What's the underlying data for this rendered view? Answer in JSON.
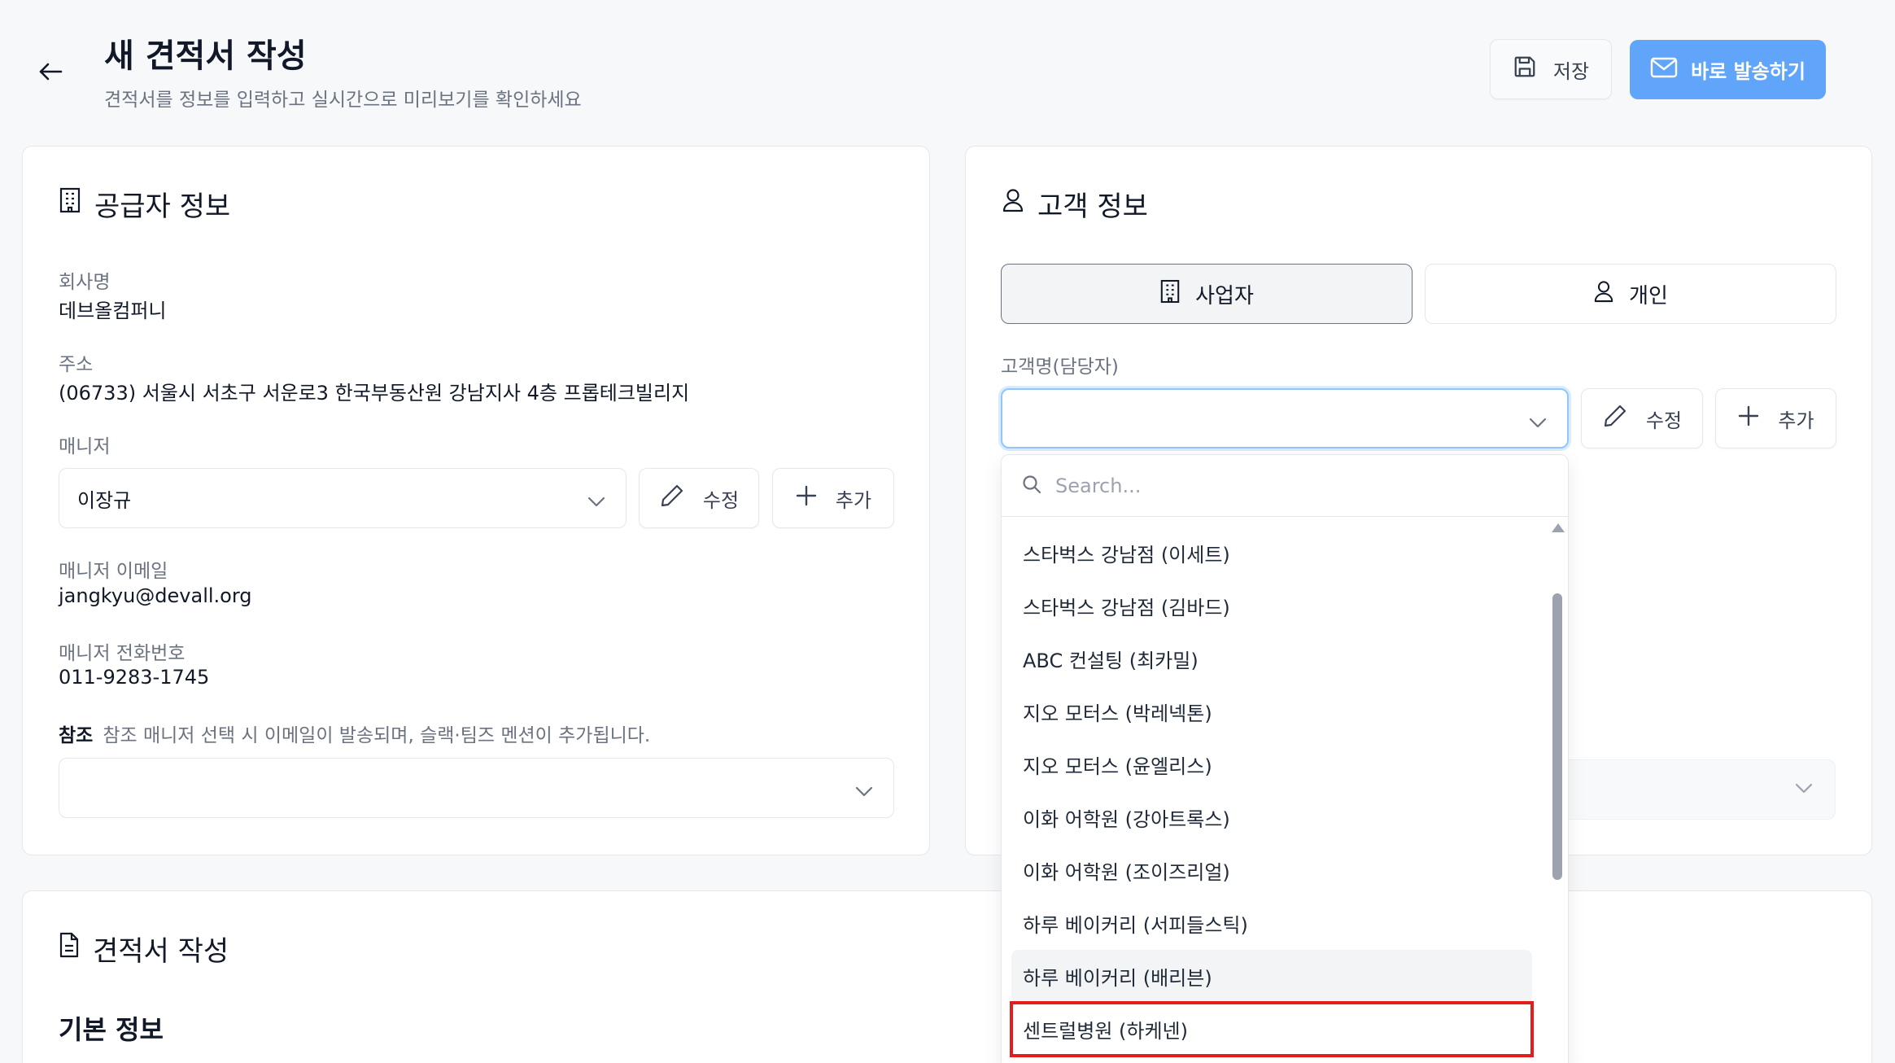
{
  "header": {
    "title": "새 견적서 작성",
    "subtitle": "견적서를 정보를 입력하고 실시간으로 미리보기를 확인하세요",
    "save_label": "저장",
    "send_label": "바로 발송하기"
  },
  "supplier": {
    "title": "공급자 정보",
    "company_label": "회사명",
    "company_value": "데브올컴퍼니",
    "address_label": "주소",
    "address_value": "(06733) 서울시 서초구 서운로3 한국부동산원 강남지사 4층 프롭테크빌리지",
    "manager_label": "매니저",
    "manager_value": "이장규",
    "edit_label": "수정",
    "add_label": "추가",
    "email_label": "매니저 이메일",
    "email_value": "jangkyu@devall.org",
    "phone_label": "매니저 전화번호",
    "phone_value": "011-9283-1745",
    "ref_label": "참조",
    "ref_help": "참조 매니저 선택 시 이메일이 발송되며, 슬랙·팀즈 멘션이 추가됩니다.",
    "ref_value": ""
  },
  "customer": {
    "title": "고객 정보",
    "tab_business": "사업자",
    "tab_individual": "개인",
    "name_label": "고객명(담당자)",
    "name_value": "",
    "edit_label": "수정",
    "add_label": "추가"
  },
  "dropdown": {
    "search_placeholder": "Search...",
    "items": [
      "스타벅스 강남점 (이세트)",
      "스타벅스 강남점 (김바드)",
      "ABC 컨설팅 (최카밀)",
      "지오 모터스 (박레넥톤)",
      "지오 모터스 (윤엘리스)",
      "이화 어학원 (강아트록스)",
      "이화 어학원 (조이즈리얼)",
      "하루 베이커리 (서피들스틱)",
      "하루 베이커리 (배리븐)",
      "센트럴병원 (하케넨)"
    ],
    "hover_index": 8,
    "highlight_index": 9
  },
  "quote": {
    "title": "견적서 작성",
    "basic_info": "기본 정보"
  },
  "colors": {
    "primary": "#60a5fa",
    "highlight": "#e11d1d",
    "focus": "#93c5fd"
  }
}
